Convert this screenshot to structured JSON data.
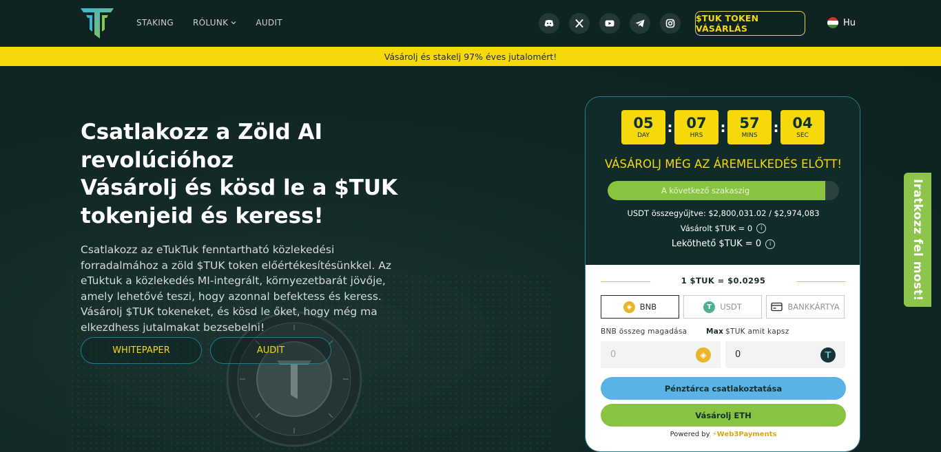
{
  "header": {
    "nav": [
      {
        "label": "STAKING"
      },
      {
        "label": "RÓLUNK"
      },
      {
        "label": "AUDIT"
      }
    ],
    "socials": [
      "discord-icon",
      "x-icon",
      "youtube-icon",
      "telegram-icon",
      "instagram-icon"
    ],
    "buy_label": "$TUK TOKEN VÁSÁRLÁS",
    "lang_label": "Hu"
  },
  "banner": {
    "text": "Vásárolj és stakelj 97% éves jutalomért!"
  },
  "hero": {
    "title_lines": [
      "Csatlakozz a  Zöld AI",
      "revolúcióhoz",
      "Vásárolj és kösd le a $TUK",
      "tokenjeid és keress!"
    ],
    "description": "Csatlakozz az eTukTuk fenntartható közlekedési forradalmához a zöld $TUK token előértékesítésünkkel. Az eTuktuk a közlekedés MI-integrált, környezetbarát jövője, amely lehetővé teszi, hogy azonnal befektess és keress. Vásárolj $TUK tokeneket, és kösd le őket, hogy még ma elkezdhess jutalmakat bezsebelni!",
    "btn_whitepaper": "WHITEPAPER",
    "btn_audit": "AUDIT"
  },
  "widget": {
    "timer": [
      {
        "value": "05",
        "unit": "DAY"
      },
      {
        "value": "07",
        "unit": "HRS"
      },
      {
        "value": "57",
        "unit": "MINS"
      },
      {
        "value": "04",
        "unit": "SEC"
      }
    ],
    "heading": "VÁSÁROLJ MÉG AZ ÁREMELKEDÉS ELŐTT!",
    "progress_label": "A következő szakaszig",
    "progress_fraction": 0.94,
    "usdt_raised": "USDT összegyűjtve: $2,800,031.02 / $2,974,083",
    "bought": "Vásárolt $TUK = 0",
    "stakeable": "Leköthető $TUK = 0",
    "price": "1 $TUK = $0.0295",
    "tabs": [
      {
        "label": "BNB",
        "icon": "bnb-icon"
      },
      {
        "label": "USDT",
        "icon": "usdt-icon"
      },
      {
        "label": "BANKKÁRTYA",
        "icon": "card-icon"
      }
    ],
    "pay_label": "BNB összeg magadása",
    "max_label": "Max",
    "receive_label": "$TUK amit kapsz",
    "pay_placeholder": "0",
    "receive_value": "0",
    "connect_label": "Pénztárca csatlakoztatása",
    "buy_eth_label": "Vásárolj ETH",
    "powered_by": "Powered by",
    "powered_brand": "Web3Payments",
    "colors": {
      "accent": "#f5d90a",
      "green": "#88c43f",
      "blue": "#5ab2e6"
    }
  },
  "side_tab": {
    "label": "Iratkozz fel most!"
  }
}
